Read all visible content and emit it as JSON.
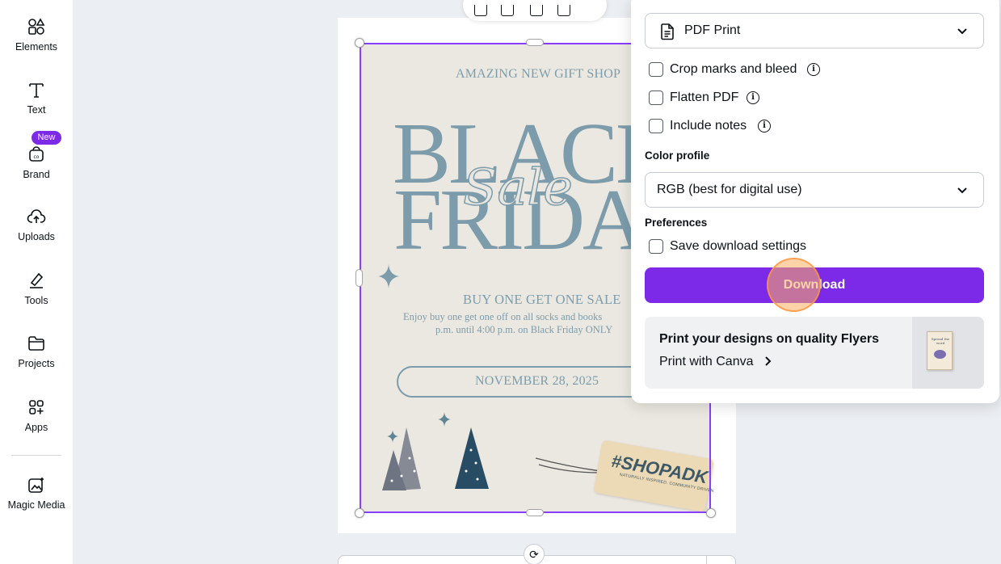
{
  "sidebar": {
    "items": [
      {
        "id": "elements",
        "label": "Elements",
        "icon": "elements-icon"
      },
      {
        "id": "text",
        "label": "Text",
        "icon": "text-icon"
      },
      {
        "id": "brand",
        "label": "Brand",
        "icon": "brand-icon",
        "badge": "New"
      },
      {
        "id": "uploads",
        "label": "Uploads",
        "icon": "upload-cloud-icon"
      },
      {
        "id": "tools",
        "label": "Tools",
        "icon": "pen-tool-icon"
      },
      {
        "id": "projects",
        "label": "Projects",
        "icon": "folder-icon"
      },
      {
        "id": "apps",
        "label": "Apps",
        "icon": "apps-grid-icon"
      },
      {
        "id": "magic_media",
        "label": "Magic Media",
        "icon": "magic-media-icon"
      }
    ]
  },
  "design": {
    "shop_line": "AMAZING NEW GIFT SHOP",
    "headline_1": "BLACK",
    "headline_2": "FRIDAY",
    "script": "Sale",
    "offer": "BUY ONE GET ONE SALE",
    "body_1": "Enjoy buy one get one off on all socks and books",
    "body_2": "p.m. until 4:00 p.m. on Black Friday ONLY",
    "date": "NOVEMBER 28, 2025",
    "tag_text": "#SHOPADK",
    "tag_sub": "NATURALLY INSPIRED. COMMUNITY DRIVEN."
  },
  "download_panel": {
    "file_type": {
      "value": "PDF Print",
      "icon": "file-doc-icon"
    },
    "options": [
      {
        "id": "crop",
        "label": "Crop marks and bleed",
        "checked": false,
        "info": true
      },
      {
        "id": "flatten",
        "label": "Flatten PDF",
        "checked": false,
        "info": true
      },
      {
        "id": "notes",
        "label": "Include notes",
        "checked": false,
        "info": true
      }
    ],
    "color_profile": {
      "label": "Color profile",
      "value": "RGB (best for digital use)"
    },
    "preferences": {
      "label": "Preferences",
      "save_label": "Save download settings",
      "checked": false
    },
    "download_label": "Download",
    "print_card": {
      "title": "Print your designs on quality Flyers",
      "link": "Print with Canva",
      "thumb_text": "Spread the word"
    }
  },
  "colors": {
    "accent": "#7d2ae8",
    "selection": "#8b3dff",
    "design_bg": "#ebe8e1",
    "design_text": "#7c9cab"
  }
}
